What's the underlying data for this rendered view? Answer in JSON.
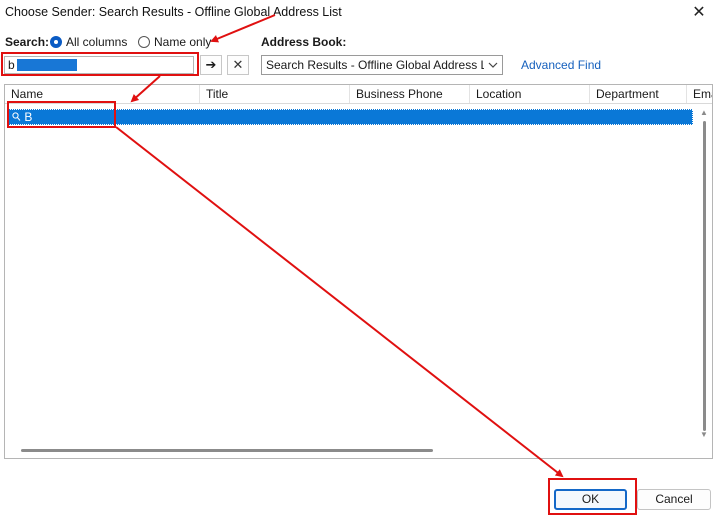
{
  "window": {
    "title": "Choose Sender: Search Results - Offline Global Address List",
    "close_glyph": "✕"
  },
  "search": {
    "label": "Search:",
    "options": [
      {
        "label": "All columns",
        "selected": true
      },
      {
        "label": "Name only",
        "selected": false
      }
    ],
    "value": "b",
    "go_glyph": "➔",
    "clear_glyph": "✕"
  },
  "address_book": {
    "label": "Address Book:",
    "selected": "Search Results - Offline Global Address List",
    "advanced_find": "Advanced Find"
  },
  "list": {
    "columns": [
      "Name",
      "Title",
      "Business Phone",
      "Location",
      "Department",
      "Ema"
    ],
    "rows": [
      {
        "icon": "search-contact-icon",
        "name": "B"
      }
    ]
  },
  "buttons": {
    "ok": "OK",
    "cancel": "Cancel"
  },
  "annotation_color": "#e01010",
  "accent_color": "#0a78d7"
}
